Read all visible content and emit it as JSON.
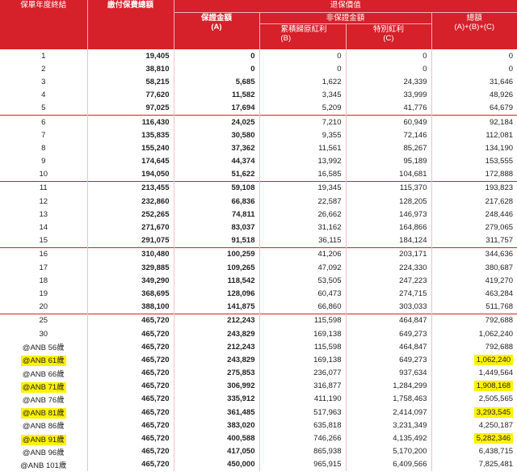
{
  "header": {
    "policy_year": "保單年度終結",
    "total_premium": "繳付保費總額",
    "surrender_value": "退保價值",
    "guaranteed": "保證金額",
    "guaranteed_code": "(A)",
    "non_guaranteed": "非保證金額",
    "reversionary_bonus": "累積歸原紅利",
    "reversionary_code": "(B)",
    "special_bonus": "特別紅利",
    "special_code": "(C)",
    "total": "總額",
    "total_formula": "(A)+(B)+(C)"
  },
  "highlight_color": "#fff200",
  "rows": [
    {
      "year": "1",
      "premium": "19,405",
      "guaranteed": "0",
      "reversionary": "0",
      "special": "0",
      "total": "0"
    },
    {
      "year": "2",
      "premium": "38,810",
      "guaranteed": "0",
      "reversionary": "0",
      "special": "0",
      "total": "0"
    },
    {
      "year": "3",
      "premium": "58,215",
      "guaranteed": "5,685",
      "reversionary": "1,622",
      "special": "24,339",
      "total": "31,646"
    },
    {
      "year": "4",
      "premium": "77,620",
      "guaranteed": "11,582",
      "reversionary": "3,345",
      "special": "33,999",
      "total": "48,926"
    },
    {
      "year": "5",
      "premium": "97,025",
      "guaranteed": "17,694",
      "reversionary": "5,209",
      "special": "41,776",
      "total": "64,679"
    },
    {
      "year": "6",
      "premium": "116,430",
      "guaranteed": "24,025",
      "reversionary": "7,210",
      "special": "60,949",
      "total": "92,184",
      "group_start": true
    },
    {
      "year": "7",
      "premium": "135,835",
      "guaranteed": "30,580",
      "reversionary": "9,355",
      "special": "72,146",
      "total": "112,081"
    },
    {
      "year": "8",
      "premium": "155,240",
      "guaranteed": "37,362",
      "reversionary": "11,561",
      "special": "85,267",
      "total": "134,190"
    },
    {
      "year": "9",
      "premium": "174,645",
      "guaranteed": "44,374",
      "reversionary": "13,992",
      "special": "95,189",
      "total": "153,555"
    },
    {
      "year": "10",
      "premium": "194,050",
      "guaranteed": "51,622",
      "reversionary": "16,585",
      "special": "104,681",
      "total": "172,888"
    },
    {
      "year": "11",
      "premium": "213,455",
      "guaranteed": "59,108",
      "reversionary": "19,345",
      "special": "115,370",
      "total": "193,823",
      "group_start": true
    },
    {
      "year": "12",
      "premium": "232,860",
      "guaranteed": "66,836",
      "reversionary": "22,587",
      "special": "128,205",
      "total": "217,628"
    },
    {
      "year": "13",
      "premium": "252,265",
      "guaranteed": "74,811",
      "reversionary": "26,662",
      "special": "146,973",
      "total": "248,446"
    },
    {
      "year": "14",
      "premium": "271,670",
      "guaranteed": "83,037",
      "reversionary": "31,162",
      "special": "164,866",
      "total": "279,065"
    },
    {
      "year": "15",
      "premium": "291,075",
      "guaranteed": "91,518",
      "reversionary": "36,115",
      "special": "184,124",
      "total": "311,757"
    },
    {
      "year": "16",
      "premium": "310,480",
      "guaranteed": "100,259",
      "reversionary": "41,206",
      "special": "203,171",
      "total": "344,636",
      "group_start": true
    },
    {
      "year": "17",
      "premium": "329,885",
      "guaranteed": "109,265",
      "reversionary": "47,092",
      "special": "224,330",
      "total": "380,687"
    },
    {
      "year": "18",
      "premium": "349,290",
      "guaranteed": "118,542",
      "reversionary": "53,505",
      "special": "247,223",
      "total": "419,270"
    },
    {
      "year": "19",
      "premium": "368,695",
      "guaranteed": "128,096",
      "reversionary": "60,473",
      "special": "274,715",
      "total": "463,284"
    },
    {
      "year": "20",
      "premium": "388,100",
      "guaranteed": "141,875",
      "reversionary": "66,860",
      "special": "303,033",
      "total": "511,768"
    },
    {
      "year": "25",
      "premium": "465,720",
      "guaranteed": "212,243",
      "reversionary": "115,598",
      "special": "464,847",
      "total": "792,688",
      "group_start": true
    },
    {
      "year": "30",
      "premium": "465,720",
      "guaranteed": "243,829",
      "reversionary": "169,138",
      "special": "649,273",
      "total": "1,062,240"
    },
    {
      "year": "@ANB 56歲",
      "premium": "465,720",
      "guaranteed": "212,243",
      "reversionary": "115,598",
      "special": "464,847",
      "total": "792,688"
    },
    {
      "year": "@ANB 61歲",
      "premium": "465,720",
      "guaranteed": "243,829",
      "reversionary": "169,138",
      "special": "649,273",
      "total": "1,062,240",
      "highlight": true
    },
    {
      "year": "@ANB 66歲",
      "premium": "465,720",
      "guaranteed": "275,853",
      "reversionary": "236,077",
      "special": "937,634",
      "total": "1,449,564"
    },
    {
      "year": "@ANB 71歲",
      "premium": "465,720",
      "guaranteed": "306,992",
      "reversionary": "316,877",
      "special": "1,284,299",
      "total": "1,908,168",
      "highlight": true
    },
    {
      "year": "@ANB 76歲",
      "premium": "465,720",
      "guaranteed": "335,912",
      "reversionary": "411,190",
      "special": "1,758,463",
      "total": "2,505,565"
    },
    {
      "year": "@ANB 81歲",
      "premium": "465,720",
      "guaranteed": "361,485",
      "reversionary": "517,963",
      "special": "2,414,097",
      "total": "3,293,545",
      "highlight": true
    },
    {
      "year": "@ANB 86歲",
      "premium": "465,720",
      "guaranteed": "383,020",
      "reversionary": "635,818",
      "special": "3,231,349",
      "total": "4,250,187"
    },
    {
      "year": "@ANB 91歲",
      "premium": "465,720",
      "guaranteed": "400,588",
      "reversionary": "746,266",
      "special": "4,135,492",
      "total": "5,282,346",
      "highlight": true
    },
    {
      "year": "@ANB 96歲",
      "premium": "465,720",
      "guaranteed": "417,050",
      "reversionary": "865,938",
      "special": "5,170,200",
      "total": "6,438,715"
    },
    {
      "year": "@ANB 101歲",
      "premium": "465,720",
      "guaranteed": "450,000",
      "reversionary": "965,915",
      "special": "6,409,566",
      "total": "7,825,481"
    }
  ]
}
